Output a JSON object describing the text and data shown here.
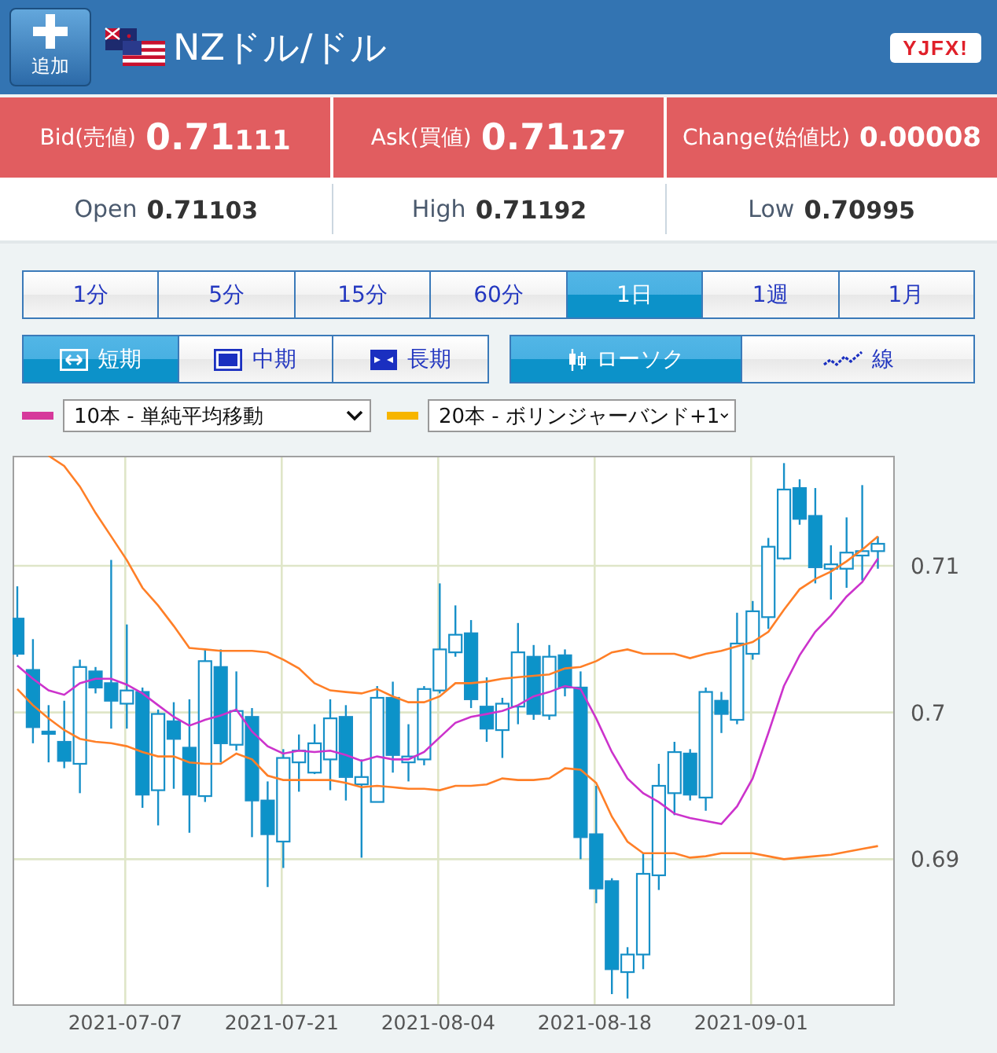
{
  "header": {
    "add_button": "追加",
    "title": "NZドル/ドル",
    "logo": "YJFX!"
  },
  "quotes": [
    {
      "label": "Bid(売値)",
      "major": "0.71",
      "minor": "111"
    },
    {
      "label": "Ask(買値)",
      "major": "0.71",
      "minor": "127"
    },
    {
      "label": "Change(始値比)",
      "major": "0.00008"
    }
  ],
  "stats": [
    {
      "label": "Open",
      "major": "0.71",
      "minor": "103"
    },
    {
      "label": "High",
      "major": "0.71",
      "minor": "192"
    },
    {
      "label": "Low",
      "major": "0.70",
      "minor": "995"
    }
  ],
  "periods": [
    {
      "label": "1分",
      "selected": false
    },
    {
      "label": "5分",
      "selected": false
    },
    {
      "label": "15分",
      "selected": false
    },
    {
      "label": "60分",
      "selected": false
    },
    {
      "label": "1日",
      "selected": true
    },
    {
      "label": "1週",
      "selected": false
    },
    {
      "label": "1月",
      "selected": false
    }
  ],
  "ranges": [
    {
      "label": "短期",
      "kind": "short",
      "selected": true
    },
    {
      "label": "中期",
      "kind": "medium",
      "selected": false
    },
    {
      "label": "長期",
      "kind": "long",
      "selected": false
    }
  ],
  "chart_types": [
    {
      "label": "ローソク",
      "kind": "candle",
      "selected": true
    },
    {
      "label": "線",
      "kind": "line",
      "selected": false
    }
  ],
  "indicators": [
    {
      "color": "#d6399b",
      "value": "10本 - 単純平均移動"
    },
    {
      "color": "#f7b500",
      "value": "20本 - ボリンジャーバンド+1"
    }
  ],
  "chart": {
    "chart_data": {
      "type": "candlestick",
      "grid": true,
      "categories": [
        null,
        null,
        null,
        null,
        null,
        null,
        null,
        "2021-07-07",
        null,
        null,
        null,
        null,
        null,
        null,
        null,
        null,
        null,
        "2021-07-21",
        null,
        null,
        null,
        null,
        null,
        null,
        null,
        null,
        null,
        "2021-08-04",
        null,
        null,
        null,
        null,
        null,
        null,
        null,
        null,
        null,
        "2021-08-18",
        null,
        null,
        null,
        null,
        null,
        null,
        null,
        null,
        null,
        "2021-09-01",
        null,
        null,
        null,
        null,
        null,
        null,
        null,
        null
      ],
      "ylim": [
        0.68,
        0.7175
      ],
      "yticks": [
        {
          "value": 0.69,
          "label": "0.69"
        },
        {
          "value": 0.7,
          "label": "0.7"
        },
        {
          "value": 0.71,
          "label": "0.71"
        }
      ],
      "ohlc": [
        [
          0.7064,
          0.7086,
          0.7038,
          0.704
        ],
        [
          0.7029,
          0.705,
          0.6979,
          0.699
        ],
        [
          0.6987,
          0.7005,
          0.6966,
          0.6986
        ],
        [
          0.698,
          0.7008,
          0.6962,
          0.6967
        ],
        [
          0.6965,
          0.7036,
          0.6945,
          0.7031
        ],
        [
          0.7028,
          0.7031,
          0.7013,
          0.7017
        ],
        [
          0.702,
          0.7104,
          0.6989,
          0.7008
        ],
        [
          0.7006,
          0.706,
          0.6989,
          0.7015
        ],
        [
          0.7014,
          0.7017,
          0.6935,
          0.6944
        ],
        [
          0.6947,
          0.7002,
          0.6923,
          0.6999
        ],
        [
          0.6994,
          0.7007,
          0.6948,
          0.6982
        ],
        [
          0.6976,
          0.7009,
          0.6918,
          0.6944
        ],
        [
          0.6943,
          0.7043,
          0.6939,
          0.7035
        ],
        [
          0.7031,
          0.7043,
          0.6966,
          0.6979
        ],
        [
          0.6978,
          0.7028,
          0.6974,
          0.7001
        ],
        [
          0.6997,
          0.7003,
          0.6915,
          0.694
        ],
        [
          0.694,
          0.6953,
          0.6881,
          0.6917
        ],
        [
          0.6912,
          0.6975,
          0.6894,
          0.6969
        ],
        [
          0.6966,
          0.6985,
          0.6946,
          0.6974
        ],
        [
          0.6959,
          0.6992,
          0.6958,
          0.6979
        ],
        [
          0.6968,
          0.7009,
          0.6947,
          0.6996
        ],
        [
          0.6997,
          0.7005,
          0.694,
          0.6956
        ],
        [
          0.6951,
          0.6968,
          0.6901,
          0.6956
        ],
        [
          0.6939,
          0.7018,
          0.6939,
          0.701
        ],
        [
          0.701,
          0.7021,
          0.6959,
          0.6971
        ],
        [
          0.6966,
          0.6992,
          0.6953,
          0.697
        ],
        [
          0.6968,
          0.7018,
          0.6964,
          0.7016
        ],
        [
          0.7015,
          0.7088,
          0.7013,
          0.7043
        ],
        [
          0.7041,
          0.7073,
          0.7038,
          0.7053
        ],
        [
          0.7054,
          0.7063,
          0.7003,
          0.7009
        ],
        [
          0.7004,
          0.7024,
          0.698,
          0.6989
        ],
        [
          0.6988,
          0.701,
          0.6969,
          0.7006
        ],
        [
          0.7004,
          0.7061,
          0.6992,
          0.7041
        ],
        [
          0.7038,
          0.7046,
          0.6995,
          0.6999
        ],
        [
          0.6998,
          0.7046,
          0.6995,
          0.7038
        ],
        [
          0.7039,
          0.7043,
          0.7011,
          0.7017
        ],
        [
          0.7017,
          0.7028,
          0.69,
          0.6915
        ],
        [
          0.6917,
          0.695,
          0.687,
          0.688
        ],
        [
          0.6885,
          0.6887,
          0.6808,
          0.6825
        ],
        [
          0.6823,
          0.684,
          0.6805,
          0.6835
        ],
        [
          0.6835,
          0.6904,
          0.6825,
          0.689
        ],
        [
          0.6889,
          0.6965,
          0.6879,
          0.695
        ],
        [
          0.6945,
          0.698,
          0.693,
          0.6973
        ],
        [
          0.6972,
          0.6975,
          0.694,
          0.6944
        ],
        [
          0.6942,
          0.7017,
          0.6933,
          0.7014
        ],
        [
          0.7008,
          0.7014,
          0.6986,
          0.6999
        ],
        [
          0.6995,
          0.7068,
          0.6992,
          0.7047
        ],
        [
          0.704,
          0.7076,
          0.7036,
          0.7069
        ],
        [
          0.7065,
          0.7119,
          0.7057,
          0.7113
        ],
        [
          0.7105,
          0.717,
          0.7104,
          0.7152
        ],
        [
          0.7153,
          0.7159,
          0.7128,
          0.7132
        ],
        [
          0.7134,
          0.7153,
          0.7088,
          0.7099
        ],
        [
          0.7098,
          0.7114,
          0.7077,
          0.7101
        ],
        [
          0.7098,
          0.7133,
          0.7085,
          0.7109
        ],
        [
          0.7107,
          0.7155,
          0.709,
          0.711
        ],
        [
          0.711,
          0.712,
          0.7098,
          0.7115
        ]
      ]
    }
  },
  "indicator_overlay": {
    "chart_data": {
      "type": "line",
      "ylim": [
        0.68,
        0.7175
      ],
      "series": [
        {
          "color": "#cc33cc",
          "values": [
            0.7032,
            0.7023,
            0.7015,
            0.7012,
            0.702,
            0.7023,
            0.7023,
            0.7019,
            0.7013,
            0.7005,
            0.6997,
            0.6991,
            0.6995,
            0.6998,
            0.7002,
            0.6987,
            0.6977,
            0.6972,
            0.6974,
            0.6973,
            0.6974,
            0.6971,
            0.6967,
            0.697,
            0.6968,
            0.6968,
            0.6973,
            0.6983,
            0.6993,
            0.6997,
            0.6999,
            0.7001,
            0.7005,
            0.7011,
            0.7014,
            0.7018,
            0.7016,
            0.6996,
            0.6973,
            0.6955,
            0.6945,
            0.6939,
            0.6931,
            0.6928,
            0.6926,
            0.6924,
            0.6936,
            0.6955,
            0.6986,
            0.7018,
            0.7039,
            0.7055,
            0.7066,
            0.7079,
            0.7089,
            0.7105
          ]
        },
        {
          "color": "#ff7f27",
          "values": [
            null,
            null,
            0.7175,
            0.7168,
            0.7154,
            0.7136,
            0.712,
            0.7104,
            0.7085,
            0.7073,
            0.7059,
            0.7044,
            0.7043,
            0.7042,
            0.7042,
            0.7042,
            0.7041,
            0.7036,
            0.703,
            0.702,
            0.7015,
            0.7014,
            0.7013,
            0.7016,
            0.7011,
            0.7007,
            0.7007,
            0.7011,
            0.702,
            0.702,
            0.7021,
            0.7023,
            0.7024,
            0.7025,
            0.7026,
            0.703,
            0.7031,
            0.7035,
            0.7041,
            0.7043,
            0.704,
            0.704,
            0.704,
            0.7037,
            0.704,
            0.7042,
            0.7045,
            0.7048,
            0.7055,
            0.707,
            0.7084,
            0.7091,
            0.7096,
            0.7103,
            0.7111,
            0.712
          ]
        },
        {
          "color": "#ff7f27",
          "values": [
            0.7016,
            0.7005,
            0.6996,
            0.6988,
            0.6982,
            0.698,
            0.6979,
            0.6977,
            0.6973,
            0.697,
            0.697,
            0.6966,
            0.6965,
            0.6965,
            0.6972,
            0.6968,
            0.6957,
            0.6954,
            0.6954,
            0.6954,
            0.6954,
            0.6952,
            0.6949,
            0.695,
            0.6949,
            0.6948,
            0.6948,
            0.6947,
            0.695,
            0.695,
            0.6951,
            0.6955,
            0.6954,
            0.6954,
            0.6955,
            0.6962,
            0.6961,
            0.6952,
            0.6929,
            0.6912,
            0.6904,
            0.6904,
            0.6904,
            0.6901,
            0.6902,
            0.6904,
            0.6904,
            0.6904,
            0.6902,
            0.69,
            0.6901,
            0.6902,
            0.6903,
            0.6905,
            0.6907,
            0.6909
          ]
        }
      ]
    }
  }
}
